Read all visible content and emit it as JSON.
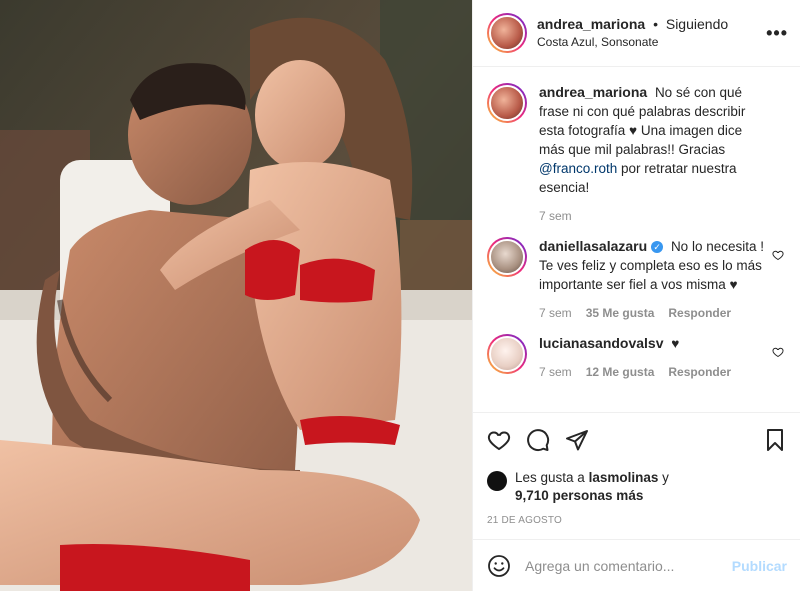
{
  "post": {
    "author": "andrea_mariona",
    "separator": "•",
    "follow_status": "Siguiendo",
    "location": "Costa Azul, Sonsonate",
    "more_icon": "more-options-icon"
  },
  "caption": {
    "username": "andrea_mariona",
    "text_before_mention": "No sé con qué frase ni con qué palabras describir esta fotografía ♥ Una imagen dice más que mil palabras!! Gracias",
    "mention": "@franco.roth",
    "text_after_mention": "por retratar nuestra esencia!",
    "time": "7 sem"
  },
  "comments": [
    {
      "username": "daniellasalazaru",
      "verified": true,
      "text": "No lo necesita ! Te ves feliz y completa eso es lo más importante ser fiel a vos misma ♥",
      "time": "7 sem",
      "likes": "35 Me gusta",
      "reply": "Responder"
    },
    {
      "username": "lucianasandovalsv",
      "verified": false,
      "text": "♥",
      "time": "7 sem",
      "likes": "12 Me gusta",
      "reply": "Responder"
    }
  ],
  "likes": {
    "prefix": "Les gusta a",
    "user": "lasmolinas",
    "connector": "y",
    "others": "9,710 personas más"
  },
  "date": "21 DE AGOSTO",
  "composer": {
    "placeholder": "Agrega un comentario...",
    "publish_label": "Publicar"
  },
  "colors": {
    "accent_blue": "#0095f6",
    "publish_disabled": "#b3dbff",
    "mention": "#00376b",
    "muted": "#8e8e8e",
    "swimsuit_red": "#c8161e"
  }
}
